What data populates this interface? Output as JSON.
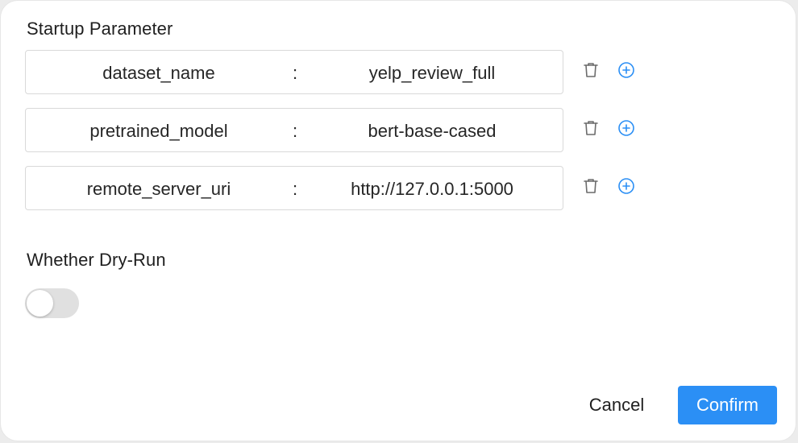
{
  "startup": {
    "title": "Startup Parameter",
    "params": [
      {
        "key": "dataset_name",
        "separator": ":",
        "value": "yelp_review_full"
      },
      {
        "key": "pretrained_model",
        "separator": ":",
        "value": "bert-base-cased"
      },
      {
        "key": "remote_server_uri",
        "separator": ":",
        "value": "http://127.0.0.1:5000"
      }
    ],
    "icons": {
      "delete": "trash-icon",
      "add": "plus-circle-icon"
    }
  },
  "dry_run": {
    "title": "Whether Dry-Run",
    "enabled": false
  },
  "footer": {
    "cancel_label": "Cancel",
    "confirm_label": "Confirm"
  },
  "colors": {
    "accent": "#2b8ff5",
    "icon_gray": "#6b6b6b",
    "toggle_off": "#e0e0e0"
  }
}
